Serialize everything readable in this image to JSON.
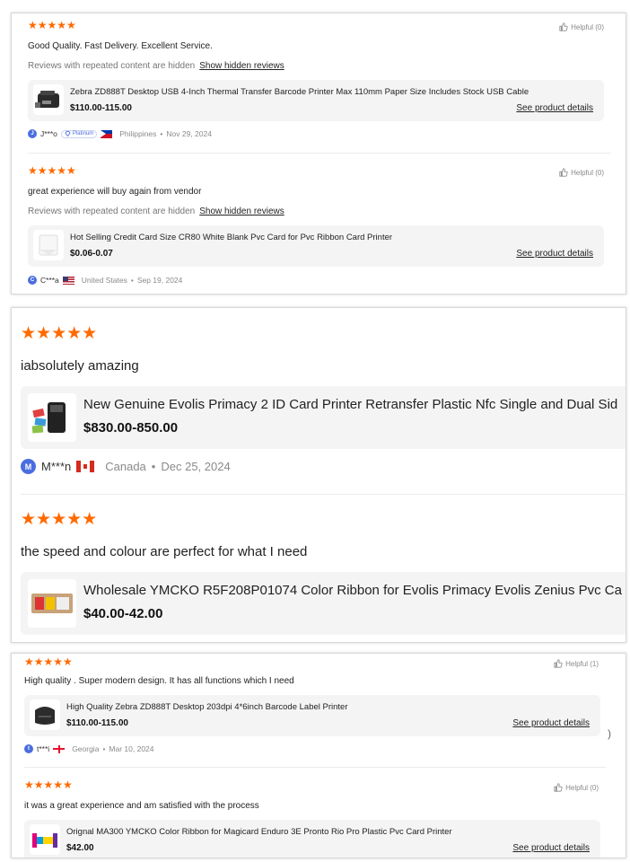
{
  "screens": [
    {
      "reviews": [
        {
          "stars": "★★★★★",
          "helpful": "Helpful (0)",
          "comment": "Good Quality. Fast Delivery. Excellent Service.",
          "hidden_note": "Reviews with repeated content are hidden",
          "show_hidden": "Show hidden reviews",
          "product_title": "Zebra ZD888T Desktop USB 4-Inch Thermal Transfer Barcode Printer Max 110mm Paper Size Includes Stock USB Cable",
          "price": "$110.00-115.00",
          "see_details": "See product details",
          "avatar": "J",
          "user": "J***o",
          "badge": "Platinum",
          "country": "Philippines",
          "date": "Nov 29, 2024"
        },
        {
          "stars": "★★★★★",
          "helpful": "Helpful (0)",
          "comment": "great experience will buy again from vendor",
          "hidden_note": "Reviews with repeated content are hidden",
          "show_hidden": "Show hidden reviews",
          "product_title": "Hot Selling Credit Card Size CR80 White Blank Pvc Card for Pvc Ribbon Card Printer",
          "price": "$0.06-0.07",
          "see_details": "See product details",
          "avatar": "C",
          "user": "C***a",
          "country": "United States",
          "date": "Sep 19, 2024"
        }
      ]
    },
    {
      "reviews": [
        {
          "stars": "★★★★★",
          "comment": "iabsolutely amazing",
          "product_title": "New Genuine Evolis Primacy 2 ID Card Printer Retransfer Plastic Nfc Single and Dual Sid",
          "price": "$830.00-850.00",
          "avatar": "M",
          "user": "M***n",
          "country": "Canada",
          "date": "Dec 25, 2024"
        },
        {
          "stars": "★★★★★",
          "comment": "the speed and colour are perfect for what I need",
          "product_title": "Wholesale YMCKO R5F208P01074 Color Ribbon for Evolis Primacy Evolis Zenius Pvc Ca",
          "price": "$40.00-42.00"
        }
      ]
    },
    {
      "reviews": [
        {
          "stars": "★★★★★",
          "helpful": "Helpful (1)",
          "comment": "High quality . Super modern design. It has all functions which I need",
          "product_title": "High Quality Zebra ZD888T Desktop 203dpi 4*6inch Barcode Label Printer",
          "price": "$110.00-115.00",
          "see_details": "See product details",
          "avatar": "t",
          "user": "t***i",
          "country": "Georgia",
          "date": "Mar 10, 2024"
        },
        {
          "stars": "★★★★★",
          "helpful": "Helpful (0)",
          "comment": "it was a great experience and am satisfied with the process",
          "product_title": "Orignal MA300 YMCKO Color Ribbon for Magicard Enduro 3E Pronto Rio Pro Plastic Pvc Card Printer",
          "price": "$42.00",
          "see_details": "See product details"
        }
      ]
    }
  ],
  "side_mark": ")",
  "colors": {
    "star": "#ff6a00",
    "avatar": "#4a6ee0",
    "card_bg": "#f4f4f4"
  },
  "icons": {
    "helpful": "thumbs-up-icon",
    "badge": "diamond-icon"
  }
}
